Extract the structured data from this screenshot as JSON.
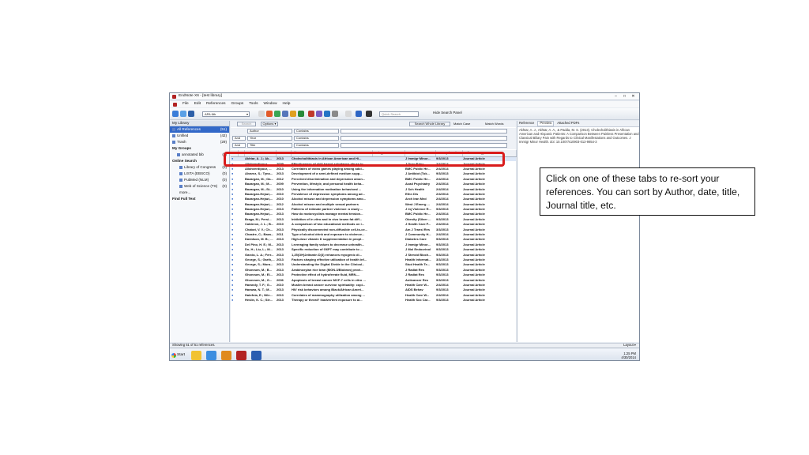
{
  "window": {
    "title": "EndNote X6 - [test library]",
    "controls": [
      "–",
      "□",
      "✕"
    ]
  },
  "menu": [
    "File",
    "Edit",
    "References",
    "Groups",
    "Tools",
    "Window",
    "Help"
  ],
  "toolbar": {
    "group_select": "APA 6th",
    "quick_search": "Quick Search",
    "hide_panel": "Hide Search Panel"
  },
  "left_panel": {
    "header": "My Library",
    "items": [
      {
        "label": "All References",
        "count": "(51)",
        "active": true
      },
      {
        "label": "Unfiled",
        "count": "(42)"
      },
      {
        "label": "Trash",
        "count": "(29)"
      },
      {
        "label": "My Groups",
        "count": "",
        "bold": true
      },
      {
        "label": "annotated bib",
        "count": "(9)",
        "indent": true
      },
      {
        "label": "Online Search",
        "count": "",
        "bold": true
      },
      {
        "label": "Library of Congress",
        "count": "(0)",
        "indent2": true
      },
      {
        "label": "LISTA (EBSCO)",
        "count": "(0)",
        "indent2": true
      },
      {
        "label": "PubMed (NLM)",
        "count": "(0)",
        "indent2": true
      },
      {
        "label": "Web of Science (TS)",
        "count": "(0)",
        "indent2": true
      },
      {
        "label": "more...",
        "count": "",
        "indent2": true
      },
      {
        "label": "Find Full Text",
        "count": "",
        "bold": true
      }
    ]
  },
  "search": {
    "search_btn": "Search",
    "options_btn": "Options ▾",
    "whole_library": "Search Whole Library",
    "match_case": "Match Case",
    "match_words": "Match Words",
    "rows": [
      {
        "bool": "",
        "field": "Author",
        "op": "Contains"
      },
      {
        "bool": "And",
        "field": "Year",
        "op": "Contains"
      },
      {
        "bool": "And",
        "field": "Title",
        "op": "Contains"
      }
    ]
  },
  "table": {
    "headers": [
      "",
      "",
      "Author",
      "Year",
      "Title",
      "Rating",
      "Journal",
      "Last Updated",
      "Reference Type"
    ],
    "rows": [
      [
        "Akhtar, A. J.; Ak...",
        "2013",
        "Cholecholithiasis in African American and Hi...",
        "J Immigr Minor...",
        "9/3/2013",
        "Journal Article"
      ],
      [
        "Allahverdipour, ...",
        "2009",
        "Effectiveness of skill-based substance abuse in...",
        "J Drug Educ",
        "2/4/2014",
        "Journal Article"
      ],
      [
        "Allahverdipour, ...",
        "2013",
        "Correlates of video games playing among adol...",
        "BMC Public He...",
        "2/4/2014",
        "Journal Article"
      ],
      [
        "Alvarez, S.; Tyna...",
        "2013",
        "Development of a semi-defined medium supp...",
        "J Antibiot (Tok...",
        "9/3/2013",
        "Journal Article"
      ],
      [
        "Bazargan, M.; Ga...",
        "2012",
        "Perceived discrimination and depression amon...",
        "BMC Public He...",
        "2/4/2014",
        "Journal Article"
      ],
      [
        "Bazargan, M.; M...",
        "2009",
        "Prevention, lifestyle, and personal health beha...",
        "Acad Psychiatry",
        "2/4/2014",
        "Journal Article"
      ],
      [
        "Bazargan, M.; St...",
        "2010",
        "Using the information motivation behavioral ...",
        "J Sch Health",
        "2/4/2014",
        "Journal Article"
      ],
      [
        "Bazargan-Hejazi,...",
        "2010",
        "Prevalence of depression symptoms among ad...",
        "Ethn Dis",
        "2/4/2014",
        "Journal Article"
      ],
      [
        "Bazargan-Hejazi,...",
        "2010",
        "Alcohol misuse and depression symptoms amo...",
        "Arch Iran Med",
        "2/4/2014",
        "Journal Article"
      ],
      [
        "Bazargan-Hejazi,...",
        "2012",
        "Alcohol misuse and multiple sexual partners",
        "West J Emerg ...",
        "2/4/2014",
        "Journal Article"
      ],
      [
        "Bazargan-Hejazi,...",
        "2013",
        "Patterns of intimate partner violence: a study ...",
        "J Inj Violence R...",
        "9/3/2013",
        "Journal Article"
      ],
      [
        "Bazargan-Hejazi,...",
        "2013",
        "How do motorcyclists manage mental tension...",
        "BMC Public He...",
        "2/4/2014",
        "Journal Article"
      ],
      [
        "Braga, M.; Persi...",
        "2013",
        "Inhibition of in vitro and in vivo brown fat diff...",
        "Obesity (Silver ...",
        "9/3/2013",
        "Journal Article"
      ],
      [
        "Calderon, J. L.; B...",
        "2010",
        "A comparison of two educational methods on i...",
        "J Health Care P...",
        "2/4/2014",
        "Journal Article"
      ],
      [
        "Chabot, V. V.; Ch...",
        "2013",
        "Physically disconnected non-diffusible cell-to-ce...",
        "Am J Transl Res",
        "3/3/2013",
        "Journal Article"
      ],
      [
        "Chastre, C.; Baza...",
        "2011",
        "Type of alcohol drink and exposure to violence...",
        "J Community H...",
        "2/4/2014",
        "Journal Article"
      ],
      [
        "Davidson, M. B.; ...",
        "2013",
        "High-dose vitamin D supplementation in peopl...",
        "Diabetes Care",
        "9/3/2013",
        "Journal Article"
      ],
      [
        "Del Pino, H. E.; M...",
        "2013",
        "Leveraging family values to decrease unhealth...",
        "J Immigr Minor...",
        "9/3/2013",
        "Journal Article"
      ],
      [
        "Du, H.; Liu, L.; M...",
        "2013",
        "Specific reduction of G6PT may contribute to ...",
        "J Mol Endocrinol",
        "9/3/2013",
        "Journal Article"
      ],
      [
        "Garcia, L. A.; Ferr...",
        "2013",
        "1,25(OH)2vitamin D(3) enhances myogenic di...",
        "J Steroid Bioch...",
        "9/3/2013",
        "Journal Article"
      ],
      [
        "George, S.; Garth,...",
        "2013",
        "Factors shaping effective utilization of health inf...",
        "Health Informat...",
        "3/3/2013",
        "Journal Article"
      ],
      [
        "George, S.; Mora...",
        "2013",
        "Understanding the Digital Divide in the Clinical...",
        "Stud Health Te...",
        "9/3/2013",
        "Journal Article"
      ],
      [
        "Ghoneum, M.; B...",
        "2013",
        "Arabinoxylan rice bran (MGN-3/Biobran) provi...",
        "J Radiat Res",
        "9/3/2013",
        "Journal Article"
      ],
      [
        "Ghoneum, M.; El...",
        "2013",
        "Protective effect of hydroferrate fluid, MRN-...",
        "J Radiat Res",
        "9/3/2013",
        "Journal Article"
      ],
      [
        "Ghoneum, M.; G...",
        "2006",
        "Apoptosis of breast cancer MCF-7 cells in vitro ...",
        "Anticancer Res",
        "9/3/2013",
        "Journal Article"
      ],
      [
        "Harandy, T. F.; G...",
        "2010",
        "Muslim breast cancer survivor spirituality: copi...",
        "Health Care W...",
        "2/4/2014",
        "Journal Article"
      ],
      [
        "Harawa, N. T.; M...",
        "2013",
        "HIV risk behaviors among Black/African Ameri...",
        "AIDS Behav",
        "9/3/2013",
        "Journal Article"
      ],
      [
        "Hatefnia, E.; Nile...",
        "2010",
        "Correlates of mammography utilization among ...",
        "Health Care W...",
        "2/4/2014",
        "Journal Article"
      ],
      [
        "Heslin, K. C.; Sle...",
        "2013",
        "Therapy or threat? Inadvertent exposure to al...",
        "Health Soc Car...",
        "9/3/2013",
        "Journal Article"
      ]
    ]
  },
  "right_panel": {
    "tabs": [
      "Reference",
      "Preview",
      "Attached PDFs"
    ],
    "preview": "Akhtar, A. J., Akhtar, A. A., & Padda, M. S. (2013). Cholecholithiasis in African American and Hispanic Patients: A Comparison Between Painless Presentation and Classical Biliary Pain with Regards to Clinical Manifestations and Outcomes. J Immigr Minor Health. doi: 10.1007/s10903-013-9854-3"
  },
  "status": {
    "text": "Showing 51 of 51 references.",
    "layout": "Layout ▾"
  },
  "taskbar": {
    "start": "Start",
    "time": "1:25 PM",
    "date": "4/30/2014"
  },
  "callout": {
    "text": "Click on one of these tabs to re-sort your references.  You can sort by Author, date, title, Journal title, etc."
  },
  "colors": {
    "highlight": "#d91c1c",
    "selection": "#3268c8"
  }
}
